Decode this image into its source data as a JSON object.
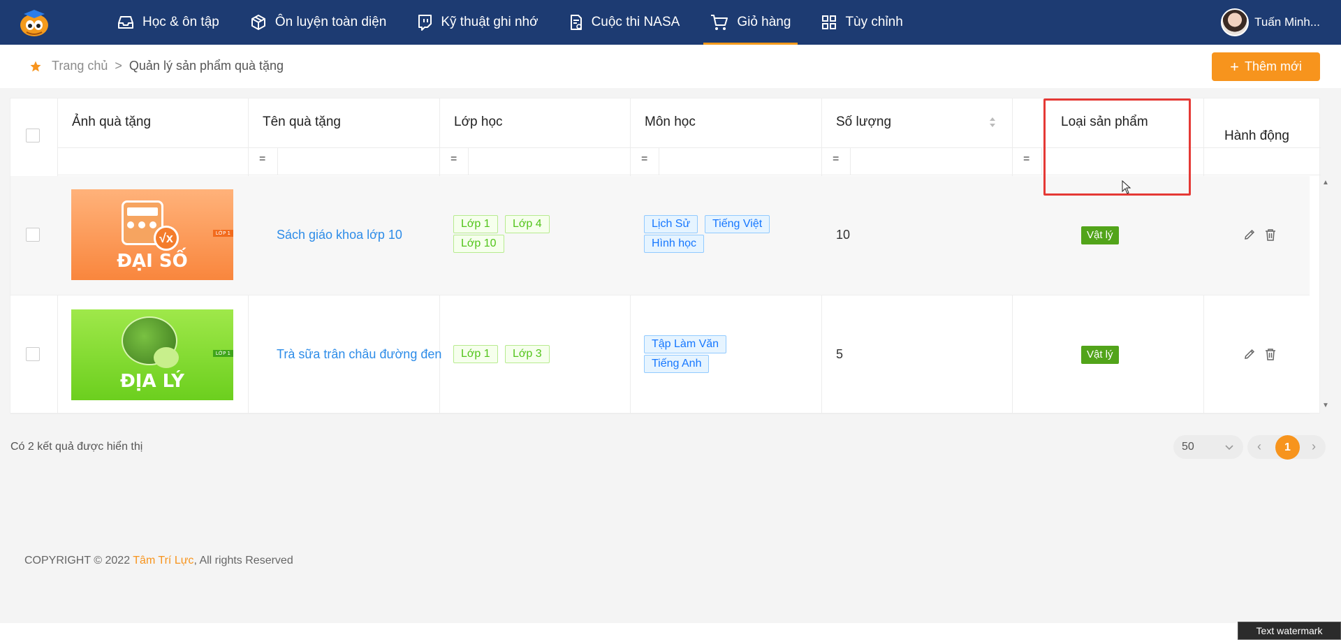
{
  "nav": {
    "items": [
      {
        "label": "Học & ôn tập",
        "icon": "inbox-icon"
      },
      {
        "label": "Ôn luyện toàn diện",
        "icon": "cube-icon"
      },
      {
        "label": "Kỹ thuật ghi nhớ",
        "icon": "twitch-icon"
      },
      {
        "label": "Cuộc thi NASA",
        "icon": "document-icon"
      },
      {
        "label": "Giỏ hàng",
        "icon": "cart-icon",
        "active": true
      },
      {
        "label": "Tùy chỉnh",
        "icon": "grid-icon"
      }
    ],
    "user_name": "Tuấn Minh..."
  },
  "breadcrumb": {
    "home": "Trang chủ",
    "separator": ">",
    "current": "Quản lý sản phẩm quà tặng"
  },
  "add_button": "Thêm mới",
  "table": {
    "columns": [
      "Ảnh quà tặng",
      "Tên quà tặng",
      "Lớp học",
      "Môn học",
      "Số lượng",
      "Loại sản phẩm",
      "Hành động"
    ],
    "filter_operator": "=",
    "rows": [
      {
        "image_title": "ĐẠI SỐ",
        "image_badge": "LỚP 1",
        "name": "Sách giáo khoa lớp 10",
        "classes": [
          "Lớp 1",
          "Lớp 4",
          "Lớp 10"
        ],
        "subjects": [
          "Lịch Sử",
          "Tiếng Việt",
          "Hình học"
        ],
        "quantity": "10",
        "type": "Vật lý"
      },
      {
        "image_title": "ĐỊA LÝ",
        "image_badge": "LỚP 1",
        "name": "Trà sữa trân châu đường đen",
        "classes": [
          "Lớp 1",
          "Lớp 3"
        ],
        "subjects": [
          "Tập Làm Văn",
          "Tiếng Anh"
        ],
        "quantity": "5",
        "type": "Vật lý"
      }
    ]
  },
  "result_text": "Có 2 kết quả được hiển thị",
  "pagination": {
    "page_size": "50",
    "current_page": "1"
  },
  "footer": {
    "prefix": "COPYRIGHT © 2022 ",
    "brand": "Tâm Trí Lực",
    "suffix": ", All rights Reserved"
  },
  "watermark": "Text watermark",
  "colors": {
    "nav_bg": "#1d3b72",
    "accent": "#f7941d",
    "link": "#2d8ce8",
    "highlight": "#e53935"
  }
}
